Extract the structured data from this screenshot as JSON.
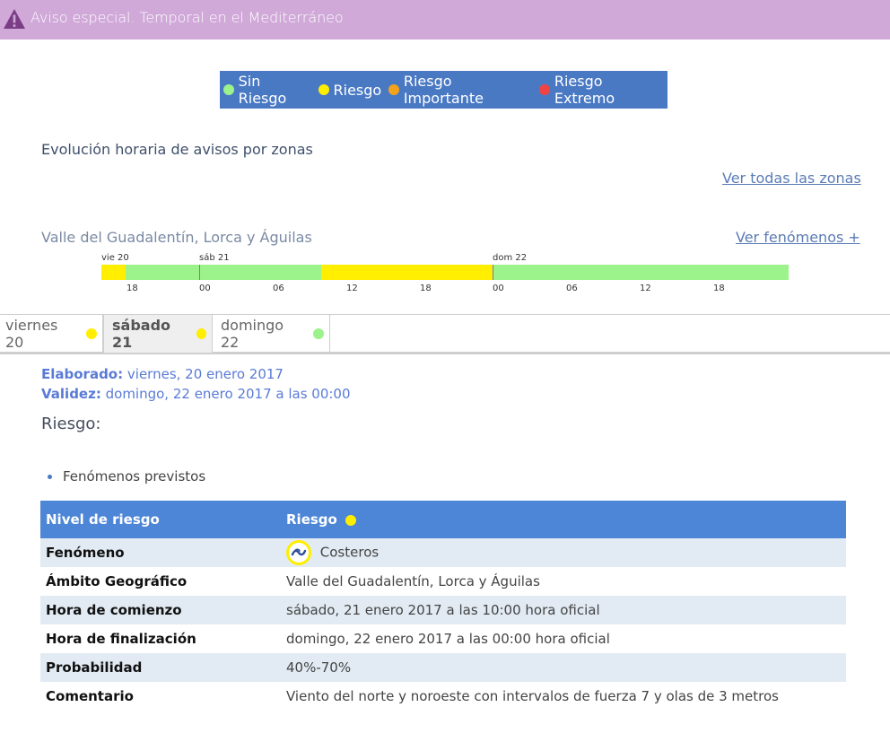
{
  "banner": {
    "text": "Aviso especial. Temporal en el Mediterráneo"
  },
  "legend": [
    {
      "label": "Sin Riesgo",
      "color": "#9cf28b"
    },
    {
      "label": "Riesgo",
      "color": "#ffee00"
    },
    {
      "label": "Riesgo Importante",
      "color": "#f5a21b"
    },
    {
      "label": "Riesgo Extremo",
      "color": "#f04444"
    }
  ],
  "section": {
    "title": "Evolución horaria de avisos por zonas",
    "all_zones_link": "Ver todas las zonas"
  },
  "zone": {
    "name": "Valle del Guadalentín, Lorca y Águilas",
    "phenomena_link": "Ver fenómenos +"
  },
  "timeline": {
    "day_labels": [
      "vie 20",
      "sáb 21",
      "dom 22"
    ],
    "hour_ticks": [
      "18",
      "00",
      "06",
      "12",
      "18",
      "00",
      "06",
      "12",
      "18"
    ]
  },
  "tabs": [
    {
      "label": "viernes 20",
      "color": "#ffee00"
    },
    {
      "label": "sábado 21",
      "color": "#ffee00"
    },
    {
      "label": "domingo 22",
      "color": "#9cf28b"
    }
  ],
  "meta": {
    "elaborado_label": "Elaborado:",
    "elaborado_value": "viernes, 20 enero 2017",
    "validez_label": "Validez:",
    "validez_value": "domingo, 22 enero 2017 a las 00:00"
  },
  "riesgo_title": "Riesgo:",
  "bullet": "Fenómenos previstos",
  "table": {
    "header_key": "Nivel de riesgo",
    "header_value": "Riesgo",
    "rows": [
      {
        "key": "Fenómeno",
        "value": "Costeros"
      },
      {
        "key": "Ámbito Geográfico",
        "value": "Valle del Guadalentín, Lorca y Águilas"
      },
      {
        "key": "Hora de comienzo",
        "value": "sábado, 21 enero 2017 a las 10:00 hora oficial"
      },
      {
        "key": "Hora de finalización",
        "value": "domingo, 22 enero 2017 a las 00:00 hora oficial"
      },
      {
        "key": "Probabilidad",
        "value": "40%-70%"
      },
      {
        "key": "Comentario",
        "value": "Viento del norte y noroeste con intervalos de fuerza 7 y olas de 3 metros"
      }
    ]
  }
}
